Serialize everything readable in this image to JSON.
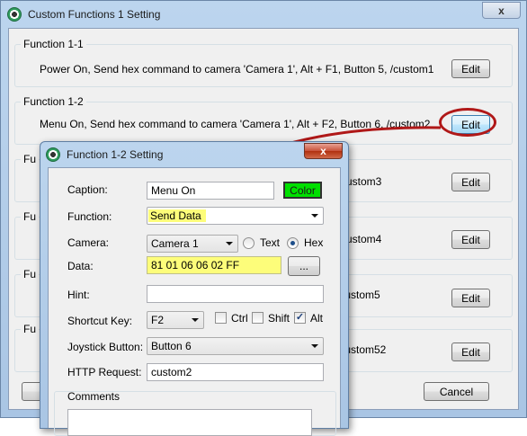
{
  "main_window": {
    "title": "Custom Functions 1 Setting",
    "close_label": "x",
    "functions": [
      {
        "label": "Function 1-1",
        "description": "Power On, Send hex command to camera 'Camera 1', Alt + F1, Button 5, /custom1",
        "edit_label": "Edit"
      },
      {
        "label": "Function 1-2",
        "description": "Menu On, Send hex command to camera 'Camera 1', Alt + F2, Button 6, /custom2",
        "edit_label": "Edit"
      },
      {
        "label": "Fu",
        "description": "custom3",
        "edit_label": "Edit"
      },
      {
        "label": "Fu",
        "description": "custom4",
        "edit_label": "Edit"
      },
      {
        "label": "Fu",
        "description": "/custom5",
        "edit_label": "Edit"
      },
      {
        "label": "Fu",
        "description": "/custom52",
        "edit_label": "Edit"
      }
    ],
    "cancel_label": "Cancel"
  },
  "dialog": {
    "title": "Function 1-2 Setting",
    "close_label": "x",
    "caption_label": "Caption:",
    "caption_value": "Menu On",
    "color_label": "Color",
    "function_label": "Function:",
    "function_value": "Send Data",
    "camera_label": "Camera:",
    "camera_value": "Camera 1",
    "text_radio_label": "Text",
    "hex_radio_label": "Hex",
    "data_label": "Data:",
    "data_value": "81 01 06 06 02 FF",
    "browse_label": "...",
    "hint_label": "Hint:",
    "hint_value": "",
    "shortcut_label": "Shortcut Key:",
    "shortcut_value": "F2",
    "ctrl_label": "Ctrl",
    "shift_label": "Shift",
    "alt_label": "Alt",
    "joystick_label": "Joystick Button:",
    "joystick_value": "Button 6",
    "http_label": "HTTP Request:",
    "http_value": "custom2",
    "comments_label": "Comments"
  },
  "colors": {
    "highlight": "#fdfd7a",
    "color_button": "#00e000",
    "annotation": "#b01818"
  }
}
